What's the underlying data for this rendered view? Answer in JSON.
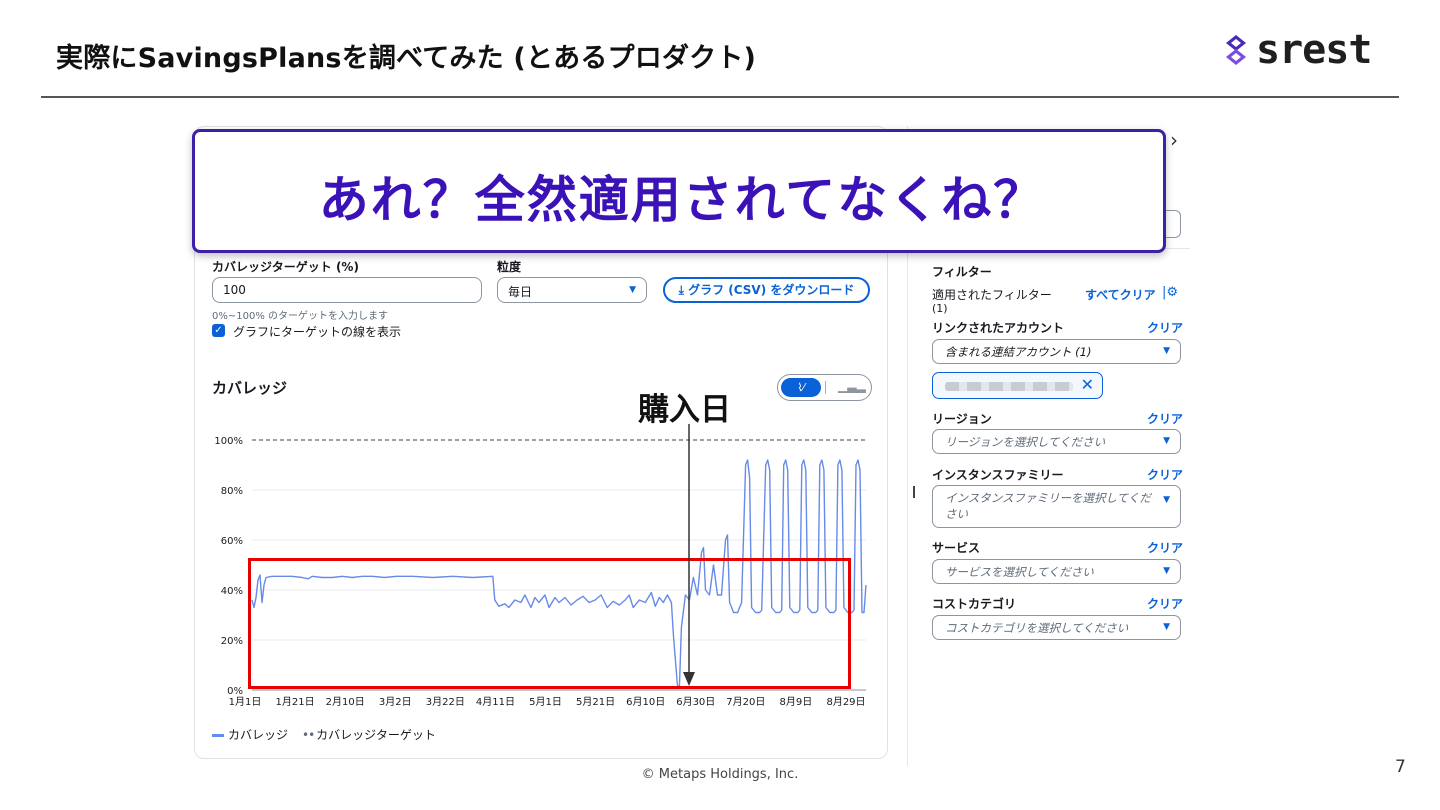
{
  "slide": {
    "title": "実際にSavingsPlansを調べてみた (とあるプロダクト)",
    "logo_text": "srest",
    "callout": "あれ？全然適用されてなくね？",
    "purchase_label": "購入日",
    "footer": "© Metaps Holdings,  Inc.",
    "page_number": "7"
  },
  "form": {
    "target_label": "カバレッジターゲット (%)",
    "target_value": "100",
    "target_hint": "0%~100% のターゲットを入力します",
    "granularity_label": "粒度",
    "granularity_value": "毎日",
    "download_button": "⤓ グラフ (CSV) をダウンロード",
    "show_target_line": "グラフにターゲットの線を表示"
  },
  "chart_heading": "カバレッジ",
  "legend": {
    "coverage": "カバレッジ",
    "target": "カバレッジターゲット"
  },
  "chart_data": {
    "type": "line",
    "ylim": [
      0,
      100
    ],
    "yticks": [
      "100%",
      "80%",
      "60%",
      "40%",
      "20%",
      "0%"
    ],
    "xticks": [
      "1月1日",
      "1月21日",
      "2月10日",
      "3月2日",
      "3月22日",
      "4月11日",
      "5月1日",
      "5月21日",
      "6月10日",
      "6月30日",
      "7月20日",
      "8月9日",
      "8月29日"
    ],
    "series": [
      {
        "name": "カバレッジ",
        "color": "#688ae8",
        "points": [
          [
            0,
            36
          ],
          [
            1,
            33
          ],
          [
            2,
            37
          ],
          [
            3,
            44
          ],
          [
            4,
            46
          ],
          [
            5,
            35
          ],
          [
            6,
            42
          ],
          [
            7,
            45
          ],
          [
            10,
            45.5
          ],
          [
            20,
            45.5
          ],
          [
            25,
            45
          ],
          [
            28,
            44.5
          ],
          [
            30,
            45.5
          ],
          [
            35,
            45
          ],
          [
            40,
            45
          ],
          [
            45,
            45.5
          ],
          [
            50,
            45
          ],
          [
            55,
            45.5
          ],
          [
            60,
            45.5
          ],
          [
            66,
            45
          ],
          [
            72,
            45.5
          ],
          [
            80,
            45.5
          ],
          [
            90,
            45
          ],
          [
            100,
            45.5
          ],
          [
            110,
            45
          ],
          [
            120,
            45.5
          ],
          [
            121,
            36
          ],
          [
            123,
            33.5
          ],
          [
            126,
            34.5
          ],
          [
            128,
            33
          ],
          [
            131,
            36
          ],
          [
            134,
            35
          ],
          [
            136,
            38
          ],
          [
            139,
            33
          ],
          [
            141,
            37
          ],
          [
            143,
            35
          ],
          [
            146,
            38
          ],
          [
            148,
            33
          ],
          [
            151,
            37
          ],
          [
            153,
            35
          ],
          [
            156,
            37
          ],
          [
            159,
            34
          ],
          [
            162,
            36
          ],
          [
            165,
            37.5
          ],
          [
            168,
            35
          ],
          [
            171,
            36
          ],
          [
            174,
            38
          ],
          [
            177,
            33
          ],
          [
            180,
            35.5
          ],
          [
            183,
            34
          ],
          [
            186,
            36
          ],
          [
            188,
            38
          ],
          [
            190,
            33
          ],
          [
            193,
            36
          ],
          [
            196,
            35
          ],
          [
            199,
            39
          ],
          [
            201,
            33.5
          ],
          [
            203,
            37
          ],
          [
            205,
            35
          ],
          [
            207,
            38
          ],
          [
            209,
            35
          ],
          [
            210,
            22
          ],
          [
            212,
            2
          ],
          [
            213,
            1
          ],
          [
            214,
            25
          ],
          [
            216,
            38
          ],
          [
            218,
            36
          ],
          [
            220,
            45
          ],
          [
            222,
            38
          ],
          [
            224,
            55
          ],
          [
            225,
            57
          ],
          [
            226,
            40
          ],
          [
            228,
            38
          ],
          [
            230,
            50
          ],
          [
            232,
            38
          ],
          [
            234,
            38
          ],
          [
            236,
            60
          ],
          [
            237,
            62
          ],
          [
            238,
            35
          ],
          [
            240,
            31
          ],
          [
            242,
            31
          ],
          [
            244,
            35
          ],
          [
            246,
            90
          ],
          [
            247,
            92
          ],
          [
            248,
            85
          ],
          [
            249,
            33
          ],
          [
            251,
            31
          ],
          [
            253,
            31
          ],
          [
            254,
            32
          ],
          [
            256,
            90
          ],
          [
            257,
            92
          ],
          [
            258,
            88
          ],
          [
            259,
            33
          ],
          [
            261,
            31
          ],
          [
            263,
            31
          ],
          [
            264,
            32
          ],
          [
            265,
            90
          ],
          [
            266,
            92
          ],
          [
            267,
            88
          ],
          [
            268,
            33
          ],
          [
            270,
            31
          ],
          [
            272,
            31
          ],
          [
            273,
            32
          ],
          [
            274,
            90
          ],
          [
            275,
            92
          ],
          [
            276,
            88
          ],
          [
            277,
            33
          ],
          [
            279,
            31
          ],
          [
            281,
            31
          ],
          [
            282,
            32
          ],
          [
            283,
            90
          ],
          [
            284,
            92
          ],
          [
            285,
            88
          ],
          [
            286,
            33
          ],
          [
            288,
            31
          ],
          [
            290,
            31
          ],
          [
            291,
            32
          ],
          [
            292,
            90
          ],
          [
            293,
            92
          ],
          [
            294,
            88
          ],
          [
            295,
            33
          ],
          [
            297,
            31
          ],
          [
            299,
            31
          ],
          [
            300,
            32
          ],
          [
            301,
            90
          ],
          [
            302,
            92
          ],
          [
            303,
            88
          ],
          [
            304,
            31
          ],
          [
            305,
            31
          ],
          [
            306,
            42
          ]
        ]
      },
      {
        "name": "カバレッジターゲット",
        "color": "#5f6b7a",
        "dashed": true,
        "points": [
          [
            0,
            100
          ],
          [
            306,
            100
          ]
        ]
      }
    ]
  },
  "filters": {
    "heading": "フィルター",
    "applied_label": "適用されたフィルター",
    "applied_count": "(1)",
    "clear_all": "すべてクリア",
    "linked_account_label": "リンクされたアカウント",
    "linked_account_value": "含まれる連結アカウント (1)",
    "region_label": "リージョン",
    "region_placeholder": "リージョンを選択してください",
    "instance_family_label": "インスタンスファミリー",
    "instance_family_placeholder_1": "インスタンスファミリーを選択してくだ",
    "instance_family_placeholder_2": "さい",
    "service_label": "サービス",
    "service_placeholder": "サービスを選択してください",
    "cost_category_label": "コストカテゴリ",
    "cost_category_placeholder": "コストカテゴリを選択してください",
    "clear": "クリア"
  }
}
